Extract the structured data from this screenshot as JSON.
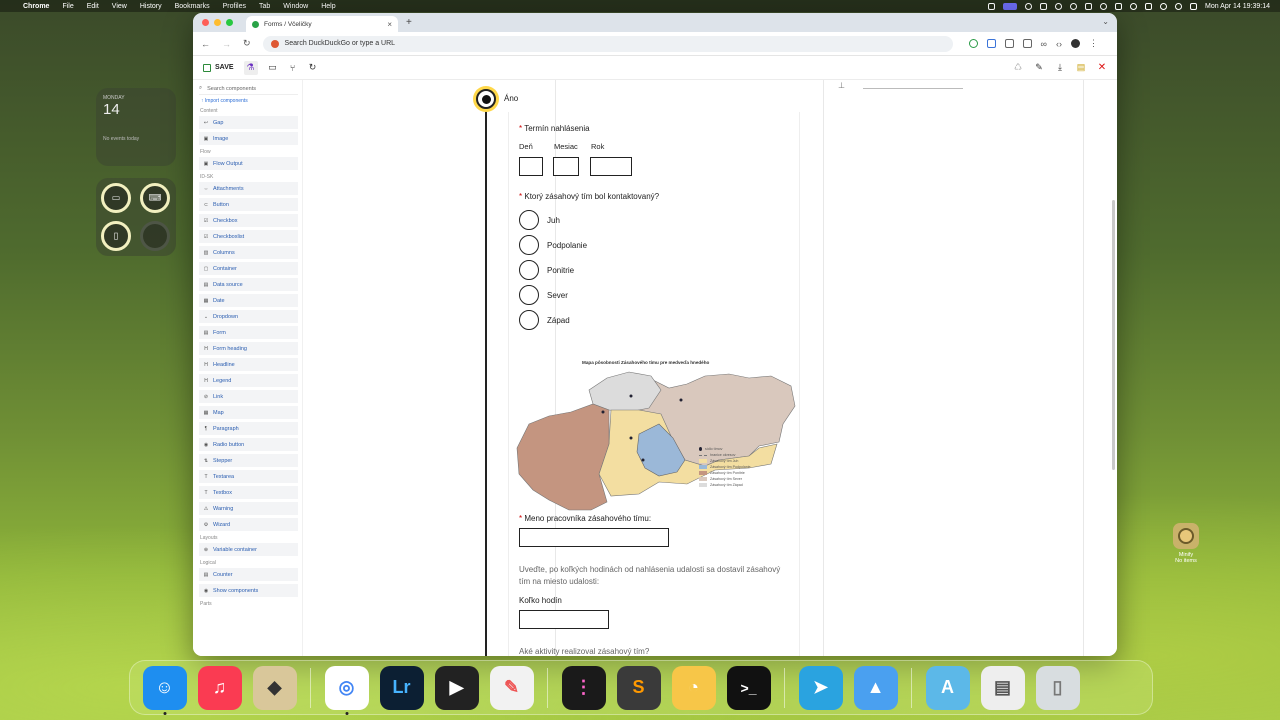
{
  "menubar": {
    "app_name": "Chrome",
    "menus": [
      "File",
      "Edit",
      "View",
      "History",
      "Bookmarks",
      "Profiles",
      "Tab",
      "Window",
      "Help"
    ],
    "clock": "Mon Apr 14  19:39:14"
  },
  "calendar_widget": {
    "day_label": "MONDAY",
    "day_number": "14",
    "no_events": "No events today"
  },
  "browser": {
    "tab_title": "Forms / Včeličky",
    "address_placeholder": "Search DuckDuckGo or type a URL",
    "traffic_colors": [
      "#fe5f57",
      "#febc2e",
      "#28c840"
    ]
  },
  "toolbar": {
    "save_label": "SAVE"
  },
  "sidebar": {
    "search_placeholder": "Search components",
    "import_label": "Import components",
    "groups": [
      {
        "label": "Content",
        "items": [
          {
            "icon": "↩",
            "label": "Gap"
          },
          {
            "icon": "▣",
            "label": "Image"
          }
        ]
      },
      {
        "label": "Flow",
        "items": [
          {
            "icon": "▣",
            "label": "Flow Output"
          }
        ]
      },
      {
        "label": "ID-SK",
        "items": [
          {
            "icon": "⇔",
            "label": "Attachments"
          },
          {
            "icon": "⊂",
            "label": "Button"
          },
          {
            "icon": "☑",
            "label": "Checkbox"
          },
          {
            "icon": "☑",
            "label": "Checkboxlist"
          },
          {
            "icon": "▥",
            "label": "Columns"
          },
          {
            "icon": "▢",
            "label": "Container"
          },
          {
            "icon": "▤",
            "label": "Data source"
          },
          {
            "icon": "▦",
            "label": "Date"
          },
          {
            "icon": "⌄",
            "label": "Dropdown"
          },
          {
            "icon": "▤",
            "label": "Form"
          },
          {
            "icon": "H",
            "label": "Form heading"
          },
          {
            "icon": "H",
            "label": "Headline"
          },
          {
            "icon": "H",
            "label": "Legend"
          },
          {
            "icon": "⊘",
            "label": "Link"
          },
          {
            "icon": "▦",
            "label": "Map"
          },
          {
            "icon": "¶",
            "label": "Paragraph"
          },
          {
            "icon": "◉",
            "label": "Radio button"
          },
          {
            "icon": "⇅",
            "label": "Stepper"
          },
          {
            "icon": "T",
            "label": "Textarea"
          },
          {
            "icon": "T",
            "label": "Textbox"
          },
          {
            "icon": "⚠",
            "label": "Warning"
          },
          {
            "icon": "⚙",
            "label": "Wizard"
          }
        ]
      },
      {
        "label": "Layouts",
        "items": [
          {
            "icon": "⊕",
            "label": "Variable container"
          }
        ]
      },
      {
        "label": "Logical",
        "items": [
          {
            "icon": "▤",
            "label": "Counter"
          },
          {
            "icon": "◉",
            "label": "Show components"
          }
        ]
      },
      {
        "label": "Parts",
        "items": []
      }
    ]
  },
  "form": {
    "yes_label": "Áno",
    "date_question": "Termín nahlásenia",
    "day_label": "Deň",
    "month_label": "Mesiac",
    "year_label": "Rok",
    "team_question": "Ktorý zásahový tím bol kontaktovaný?",
    "team_options": [
      "Juh",
      "Podpolanie",
      "Ponitrie",
      "Sever",
      "Západ"
    ],
    "map_title": "Mapa pôsobnosti Zásahového tímu pre medveďa hnedého",
    "map_legend": [
      "sídlo tímov",
      "hranice okresov",
      "Zásahový tím Juh",
      "Zásahový tím Podpolanie",
      "Zásahový tím Ponitrie",
      "Zásahový tím Sever",
      "Zásahový tím Západ"
    ],
    "worker_question": "Meno pracovníka zásahového tímu:",
    "hours_hint": "Uveďte, po koľkých hodinách od nahlásenia udalosti sa dostavil zásahový tím na miesto udalosti:",
    "hours_label": "Koľko hodín",
    "activities_question": "Aké aktivity realizoval zásahový tím?",
    "required_mark": "*"
  },
  "desktop": {
    "minify_label": "Minify",
    "minify_sub": "No items"
  },
  "dock_apps": [
    {
      "name": "Finder",
      "color": "#1e8ef0",
      "glyph": "☺"
    },
    {
      "name": "Music",
      "color": "#fa3b52",
      "glyph": "♫"
    },
    {
      "name": "Transmit",
      "color": "#d9c79a",
      "glyph": "◆"
    },
    {
      "name": "Chrome",
      "color": "#ffffff",
      "glyph": "◎"
    },
    {
      "name": "Lightroom",
      "color": "#0c1f33",
      "glyph": "Lr"
    },
    {
      "name": "Final Cut Pro",
      "color": "#222222",
      "glyph": "▶"
    },
    {
      "name": "Pixelmator",
      "color": "#f2f2f2",
      "glyph": "✎"
    },
    {
      "name": "Tot",
      "color": "#1a1a1a",
      "glyph": "⋮"
    },
    {
      "name": "Sublime Text",
      "color": "#3a3a3a",
      "glyph": "S"
    },
    {
      "name": "TablePlus",
      "color": "#f7c648",
      "glyph": "🐘"
    },
    {
      "name": "Terminal",
      "color": "#111111",
      "glyph": ">_"
    },
    {
      "name": "Telegram",
      "color": "#2aa3e0",
      "glyph": "➤"
    },
    {
      "name": "Transloader",
      "color": "#4aa0f0",
      "glyph": "▲"
    },
    {
      "name": "Applications",
      "color": "#5cb8e8",
      "glyph": "A"
    },
    {
      "name": "Documents",
      "color": "#eeeeee",
      "glyph": "▤"
    },
    {
      "name": "Trash",
      "color": "#d8dde0",
      "glyph": "🗑"
    }
  ]
}
